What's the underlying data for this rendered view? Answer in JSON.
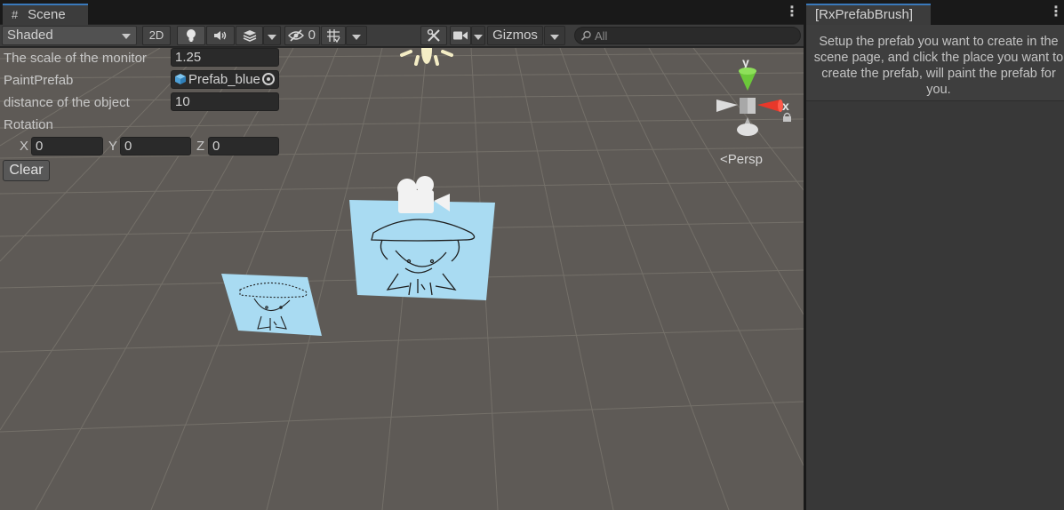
{
  "scene_tab": {
    "title": "Scene",
    "icon": "hash-icon"
  },
  "toolbar": {
    "shading_mode": "Shaded",
    "btn_2d": "2D",
    "hidden_count": "0",
    "gizmos_label": "Gizmos",
    "search_placeholder": "All"
  },
  "paint_tool": {
    "monitor_scale_label": "The scale of the monitor",
    "monitor_scale_value": "1.25",
    "paint_prefab_label": "PaintPrefab",
    "paint_prefab_value": "Prefab_blue",
    "distance_label": "distance of the object",
    "distance_value": "10",
    "rotation_label": "Rotation",
    "rotation": [
      {
        "axis": "X",
        "value": "0"
      },
      {
        "axis": "Y",
        "value": "0"
      },
      {
        "axis": "Z",
        "value": "0"
      }
    ],
    "clear_button": "Clear"
  },
  "gizmo": {
    "y_label": "y",
    "x_label": "x",
    "projection": "Persp",
    "colors": {
      "y_axis": "#6cc83a",
      "x_axis": "#e8382a",
      "neutral": "#d8d8d8"
    }
  },
  "brush_window": {
    "tab_title": "[RxPrefabBrush]",
    "help_text": "Setup the prefab you want to create in the scene page, and click the place you want to create the prefab, will paint the prefab for you."
  },
  "colors": {
    "viewport_bg": "#5e5a56",
    "grid_line": "#747069",
    "accent": "#3a79bb",
    "quad_fill": "#a9dbf2"
  }
}
